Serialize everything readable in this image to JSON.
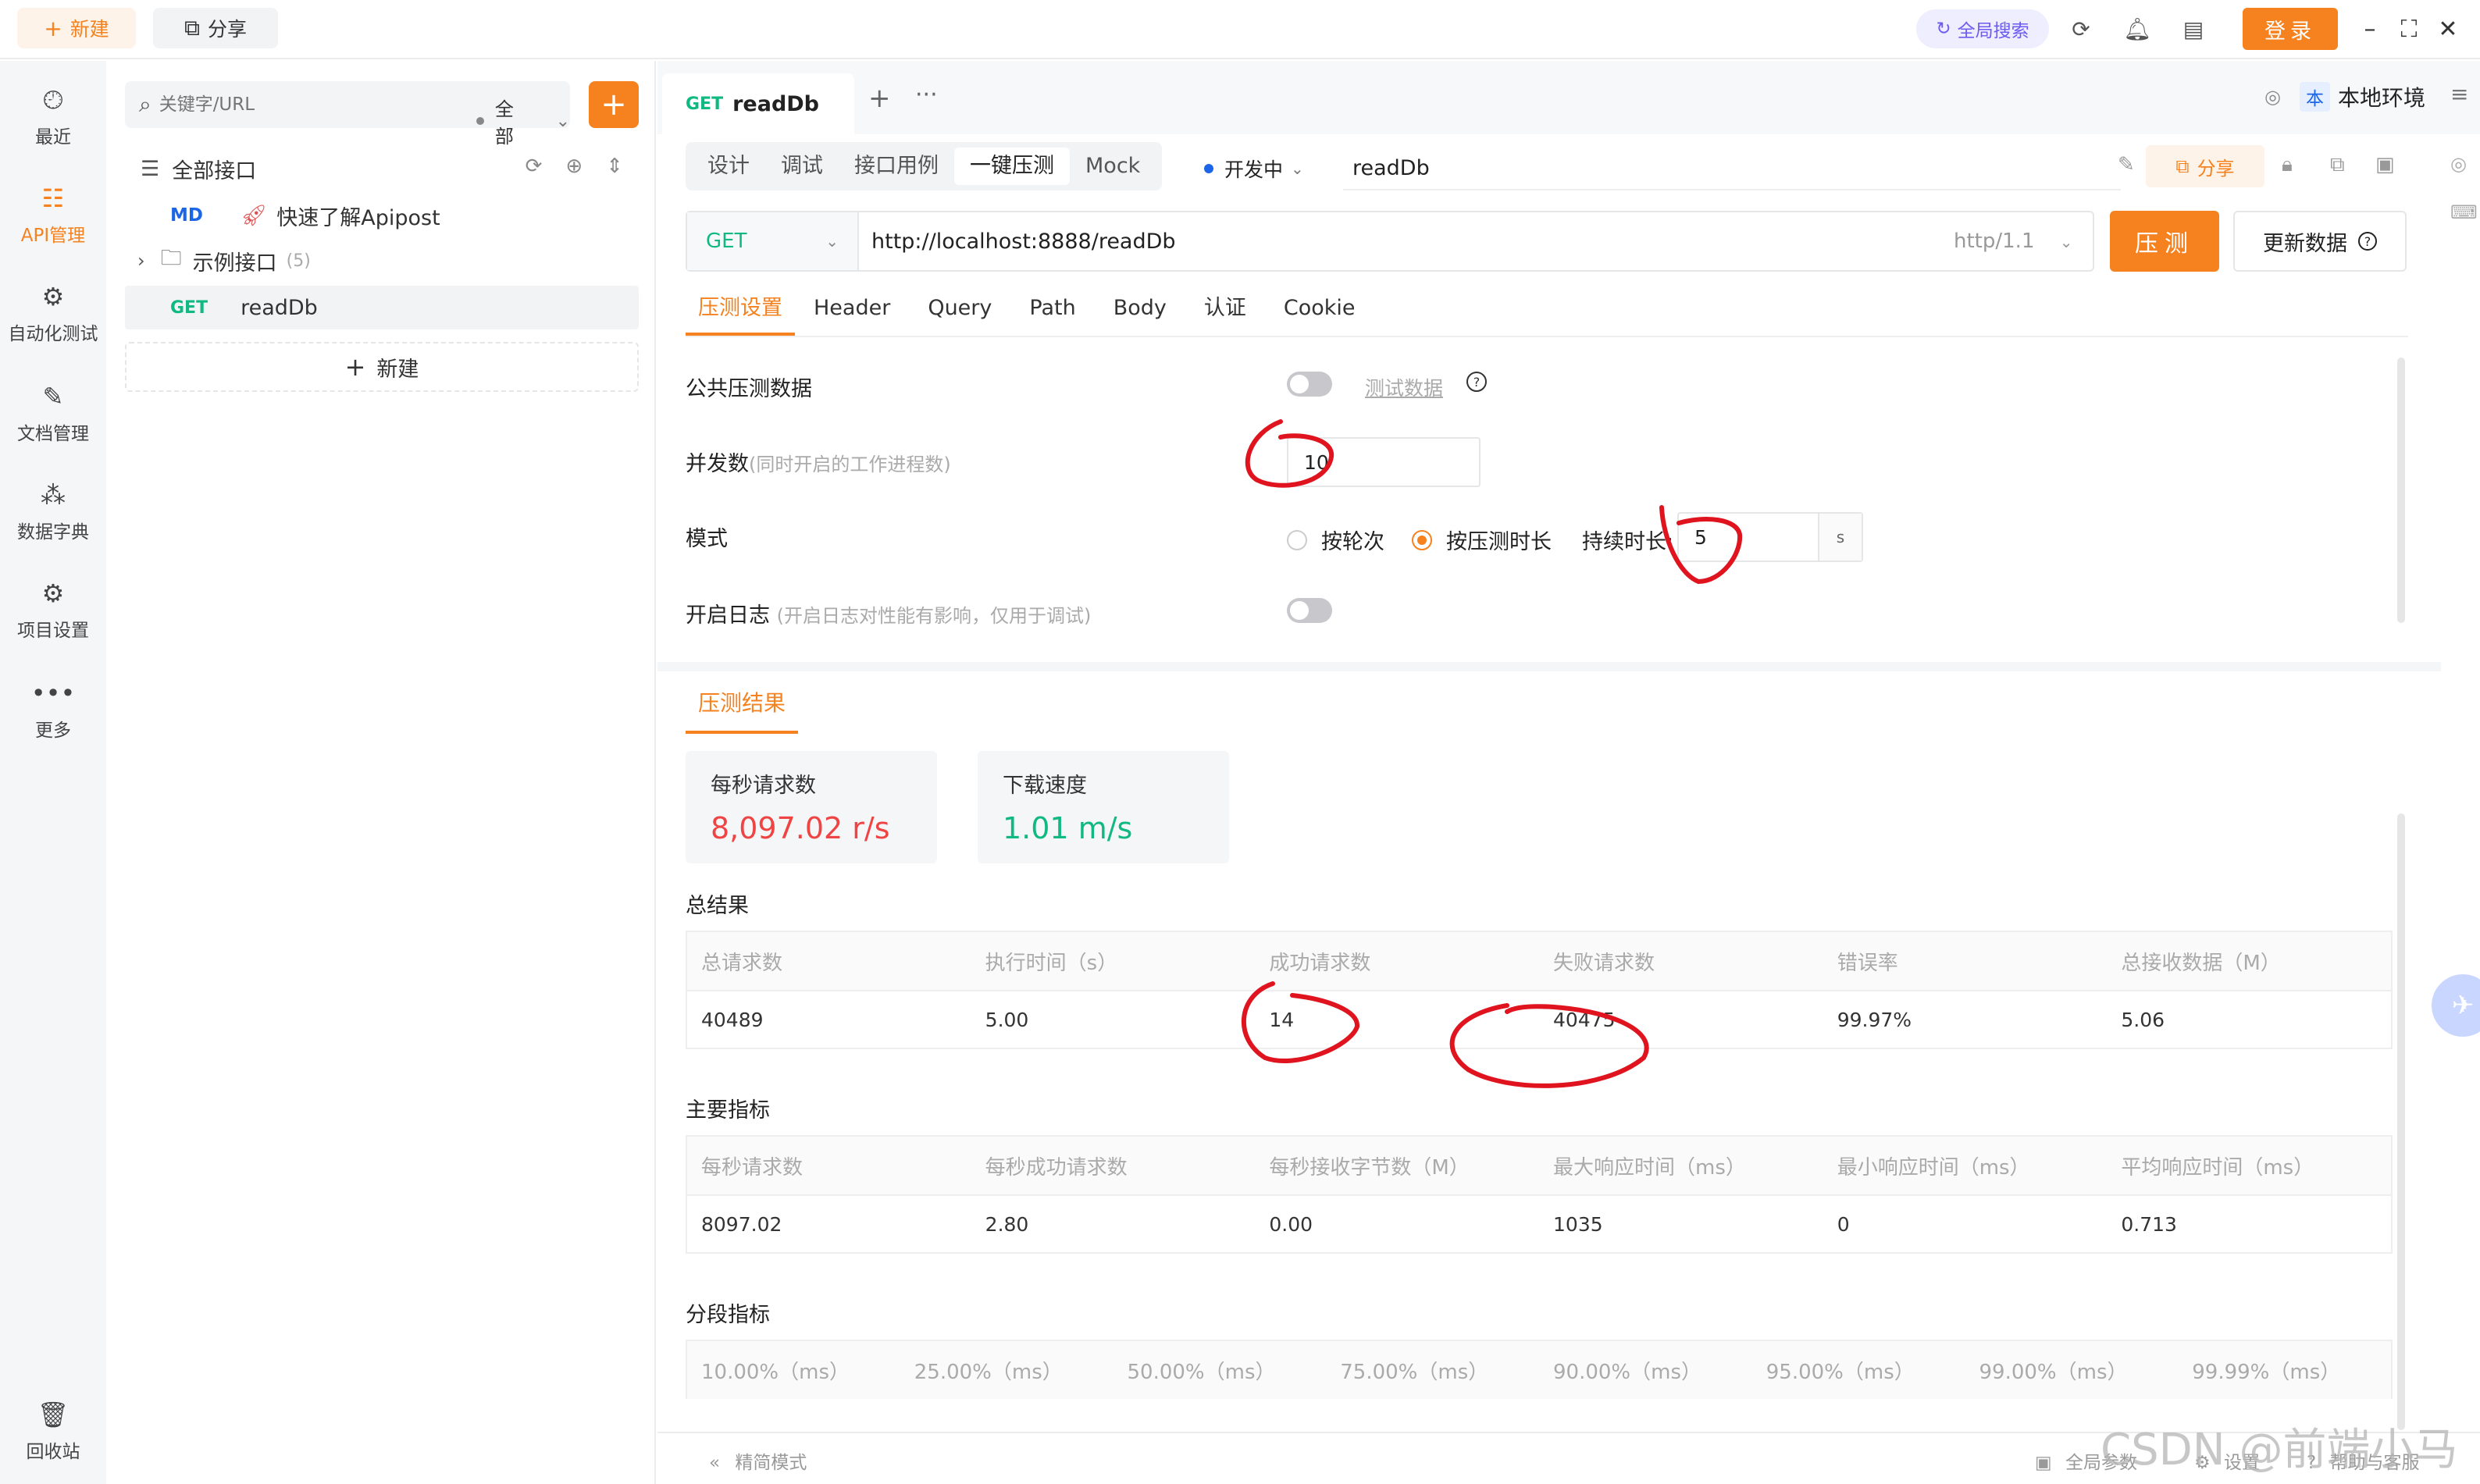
{
  "topbar": {
    "new_label": "新建",
    "share_label": "分享",
    "global_search_label": "全局搜索",
    "login_label": "登录"
  },
  "nav": {
    "items": [
      {
        "label": "最近",
        "icon": "clock-icon"
      },
      {
        "label": "API管理",
        "icon": "api-icon",
        "active": true
      },
      {
        "label": "自动化测试",
        "icon": "automation-icon"
      },
      {
        "label": "文档管理",
        "icon": "document-icon"
      },
      {
        "label": "数据字典",
        "icon": "dictionary-icon"
      },
      {
        "label": "项目设置",
        "icon": "project-settings-icon"
      },
      {
        "label": "更多",
        "icon": "more-icon"
      }
    ],
    "trash_label": "回收站"
  },
  "sidebar": {
    "search_placeholder": "关键字/URL",
    "scope": "全部",
    "all_apis": "全部接口",
    "tree": [
      {
        "method": "MD",
        "label": "快速了解Apipost"
      },
      {
        "label": "示例接口",
        "count": "(5)"
      },
      {
        "method": "GET",
        "label": "readDb"
      }
    ],
    "new_label": "新建"
  },
  "tab": {
    "method": "GET",
    "name": "readDb"
  },
  "env": {
    "badge": "本",
    "label": "本地环境"
  },
  "subtabs": [
    "设计",
    "调试",
    "接口用例",
    "一键压测",
    "Mock"
  ],
  "active_subtab": "一键压测",
  "status": "开发中",
  "api_name": "readDb",
  "share_label": "分享",
  "request": {
    "method": "GET",
    "url": "http://localhost:8888/readDb",
    "protocol": "http/1.1",
    "run_label": "压测",
    "update_label": "更新数据"
  },
  "param_tabs": [
    "压测设置",
    "Header",
    "Query",
    "Path",
    "Body",
    "认证",
    "Cookie"
  ],
  "settings": {
    "public_data_label": "公共压测数据",
    "test_data_link": "测试数据",
    "concurrency_label": "并发数",
    "concurrency_hint": "(同时开启的工作进程数)",
    "concurrency_value": "10",
    "mode_label": "模式",
    "mode_options": [
      "按轮次",
      "按压测时长"
    ],
    "mode_selected": "按压测时长",
    "duration_label": "持续时长:",
    "duration_value": "5",
    "duration_unit": "s",
    "log_label": "开启日志",
    "log_hint": "(开启日志对性能有影响，仅用于调试)"
  },
  "results": {
    "tab_label": "压测结果",
    "cards": [
      {
        "label": "每秒请求数",
        "value": "8,097.02 r/s",
        "color": "#ef4444"
      },
      {
        "label": "下载速度",
        "value": "1.01 m/s",
        "color": "#10b981"
      }
    ],
    "total_title": "总结果",
    "total_headers": [
      "总请求数",
      "执行时间（s）",
      "成功请求数",
      "失败请求数",
      "错误率",
      "总接收数据（M）"
    ],
    "total_values": [
      "40489",
      "5.00",
      "14",
      "40475",
      "99.97%",
      "5.06"
    ],
    "main_title": "主要指标",
    "main_headers": [
      "每秒请求数",
      "每秒成功请求数",
      "每秒接收字节数（M）",
      "最大响应时间（ms）",
      "最小响应时间（ms）",
      "平均响应时间（ms）"
    ],
    "main_values": [
      "8097.02",
      "2.80",
      "0.00",
      "1035",
      "0",
      "0.713"
    ],
    "segment_title": "分段指标",
    "segment_headers": [
      "10.00%（ms）",
      "25.00%（ms）",
      "50.00%（ms）",
      "75.00%（ms）",
      "90.00%（ms）",
      "95.00%（ms）",
      "99.00%（ms）",
      "99.99%（ms）"
    ]
  },
  "bottombar": {
    "simple_mode": "精简模式",
    "global_params": "全局参数",
    "settings": "设置",
    "help": "帮助与客服"
  },
  "watermark": "CSDN @前端小马",
  "colors": {
    "accent": "#f5821f",
    "get": "#10b981",
    "md": "#1c65e6",
    "annotation": "#e0141e"
  }
}
